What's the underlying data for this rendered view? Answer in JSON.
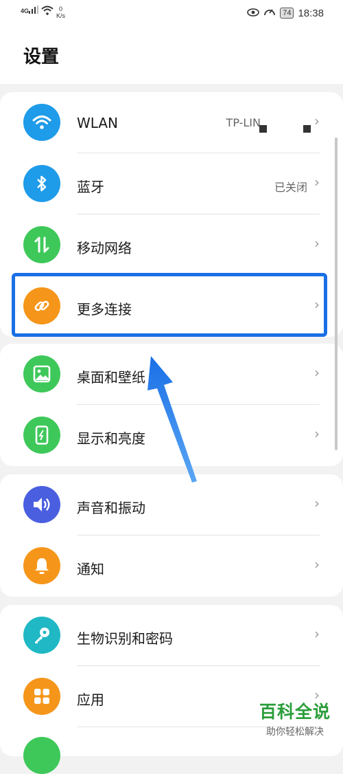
{
  "status_bar": {
    "signal": "4G",
    "net_speed_value": "0",
    "net_speed_unit": "K/s",
    "battery": "74",
    "time": "18:38"
  },
  "header": {
    "title": "设置"
  },
  "rows": [
    {
      "label": "WLAN",
      "value": "TP-LIN",
      "icon": "wifi-icon",
      "color": "#1e9be9"
    },
    {
      "label": "蓝牙",
      "value": "已关闭",
      "icon": "bluetooth-icon",
      "color": "#1e9be9"
    },
    {
      "label": "移动网络",
      "value": "",
      "icon": "mobile-data-icon",
      "color": "#3ec85a"
    },
    {
      "label": "更多连接",
      "value": "",
      "icon": "link-icon",
      "color": "#f5961a"
    },
    {
      "label": "桌面和壁纸",
      "value": "",
      "icon": "image-icon",
      "color": "#3ec85a"
    },
    {
      "label": "显示和亮度",
      "value": "",
      "icon": "phone-brightness-icon",
      "color": "#3ec85a"
    },
    {
      "label": "声音和振动",
      "value": "",
      "icon": "speaker-icon",
      "color": "#4a5fe0"
    },
    {
      "label": "通知",
      "value": "",
      "icon": "bell-icon",
      "color": "#f5961a"
    },
    {
      "label": "生物识别和密码",
      "value": "",
      "icon": "key-icon",
      "color": "#1fb8c4"
    },
    {
      "label": "应用",
      "value": "",
      "icon": "apps-grid-icon",
      "color": "#f5961a"
    }
  ],
  "chevron": "›",
  "watermark": {
    "title": "百科全说",
    "subtitle": "助你轻松解决"
  },
  "accent": "#1a6fe6"
}
